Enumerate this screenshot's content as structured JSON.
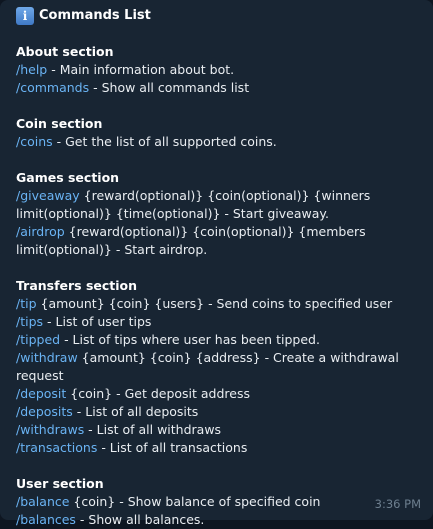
{
  "header": {
    "icon": "info-icon",
    "title": "Commands List"
  },
  "sections": [
    {
      "title": "About section",
      "lines": [
        {
          "cmd": "/help",
          "text": " - Main information about bot."
        },
        {
          "cmd": "/commands",
          "text": " - Show all commands list"
        }
      ]
    },
    {
      "title": "Coin section",
      "lines": [
        {
          "cmd": "/coins",
          "text": " - Get the list of all supported coins."
        }
      ]
    },
    {
      "title": "Games section",
      "lines": [
        {
          "cmd": "/giveaway",
          "text": " {reward(optional)} {coin(optional)} {winners limit(optional)} {time(optional)} - Start giveaway."
        },
        {
          "cmd": "/airdrop",
          "text": " {reward(optional)} {coin(optional)} {members limit(optional)} - Start airdrop."
        }
      ]
    },
    {
      "title": "Transfers section",
      "lines": [
        {
          "cmd": "/tip",
          "text": " {amount} {coin} {users} - Send coins to specified user"
        },
        {
          "cmd": "/tips",
          "text": " - List of user tips"
        },
        {
          "cmd": "/tipped",
          "text": " - List of tips where user has been tipped."
        },
        {
          "cmd": "/withdraw",
          "text": " {amount} {coin} {address} - Create a withdrawal request"
        },
        {
          "cmd": "/deposit",
          "text": " {coin} - Get deposit address"
        },
        {
          "cmd": "/deposits",
          "text": " - List of all deposits"
        },
        {
          "cmd": "/withdraws",
          "text": " - List of all withdraws"
        },
        {
          "cmd": "/transactions",
          "text": " - List of all transactions"
        }
      ]
    },
    {
      "title": "User section",
      "lines": [
        {
          "cmd": "/balance",
          "text": " {coin} - Show balance of specified coin"
        },
        {
          "cmd": "/balances",
          "text": " - Show all balances."
        }
      ]
    }
  ],
  "timestamp": "3:36 PM",
  "colors": {
    "link": "#6ab3f3",
    "bubble": "#182533",
    "text": "#e9edf1"
  }
}
